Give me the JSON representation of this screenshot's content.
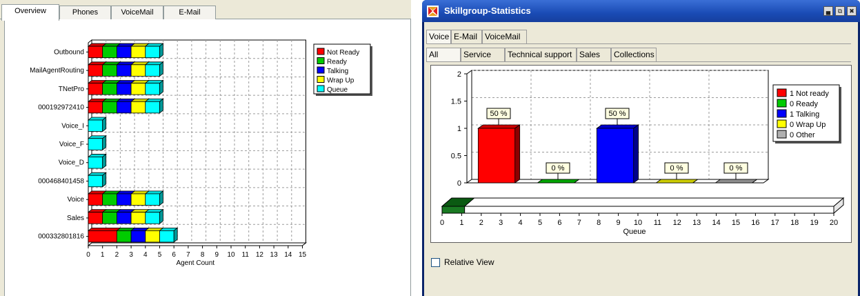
{
  "left_tabs": [
    "Overview",
    "Phones",
    "VoiceMail",
    "E-Mail"
  ],
  "right_window": {
    "title": "Skillgroup-Statistics",
    "channel_tabs": [
      "Voice",
      "E-Mail",
      "VoiceMail"
    ],
    "group_tabs": [
      "All",
      "Service",
      "Technical support",
      "Sales",
      "Collections"
    ],
    "relative_view_label": "Relative View"
  },
  "chart_data": [
    {
      "type": "bar",
      "orientation": "horizontal",
      "stacked": true,
      "categories": [
        "Outbound",
        "MailAgentRouting",
        "TNetPro",
        "000192972410",
        "Voice_I",
        "Voice_F",
        "Voice_D",
        "000468401458",
        "Voice",
        "Sales",
        "000332801816"
      ],
      "series": [
        {
          "name": "Not Ready",
          "color": "#ff0000",
          "values": [
            1,
            1,
            1,
            1,
            0,
            0,
            0,
            0,
            1,
            1,
            2
          ]
        },
        {
          "name": "Ready",
          "color": "#00cc00",
          "values": [
            1,
            1,
            1,
            1,
            0,
            0,
            0,
            0,
            1,
            1,
            1
          ]
        },
        {
          "name": "Talking",
          "color": "#0000ff",
          "values": [
            1,
            1,
            1,
            1,
            0,
            0,
            0,
            0,
            1,
            1,
            1
          ]
        },
        {
          "name": "Wrap Up",
          "color": "#ffff00",
          "values": [
            1,
            1,
            1,
            1,
            0,
            0,
            0,
            0,
            1,
            1,
            1
          ]
        },
        {
          "name": "Queue",
          "color": "#00ffff",
          "values": [
            1,
            1,
            1,
            1,
            1,
            1,
            1,
            1,
            1,
            1,
            1
          ]
        }
      ],
      "xlabel": "Agent Count",
      "xlim": [
        0,
        15
      ],
      "xticks": [
        "0",
        "1",
        "2",
        "3",
        "4",
        "5",
        "6",
        "7",
        "8",
        "9",
        "10",
        "11",
        "12",
        "13",
        "14",
        "15"
      ],
      "grid": true,
      "legend_position": "top-right"
    },
    {
      "type": "bar",
      "categories": [
        "Not ready",
        "Ready",
        "Talking",
        "Wrap Up",
        "Other"
      ],
      "values": [
        1,
        0,
        1,
        0,
        0
      ],
      "data_labels": [
        "50 %",
        "0 %",
        "50 %",
        "0 %",
        "0 %"
      ],
      "colors": [
        "#ff0000",
        "#00cc00",
        "#0000ff",
        "#ffff00",
        "#b0b0b0"
      ],
      "legend": [
        "1 Not ready",
        "0 Ready",
        "1 Talking",
        "0 Wrap Up",
        "0 Other"
      ],
      "ylim": [
        0,
        2
      ],
      "yticks": [
        "0",
        "0.5",
        "1",
        "1.5",
        "2"
      ],
      "queue_axis": {
        "label": "Queue",
        "xlim": [
          0,
          20
        ],
        "xticks": [
          "0",
          "1",
          "2",
          "3",
          "4",
          "5",
          "6",
          "7",
          "8",
          "9",
          "10",
          "11",
          "12",
          "13",
          "14",
          "15",
          "16",
          "17",
          "18",
          "19",
          "20"
        ],
        "values": [
          0.5
        ]
      },
      "grid": true,
      "legend_position": "top-right"
    }
  ]
}
